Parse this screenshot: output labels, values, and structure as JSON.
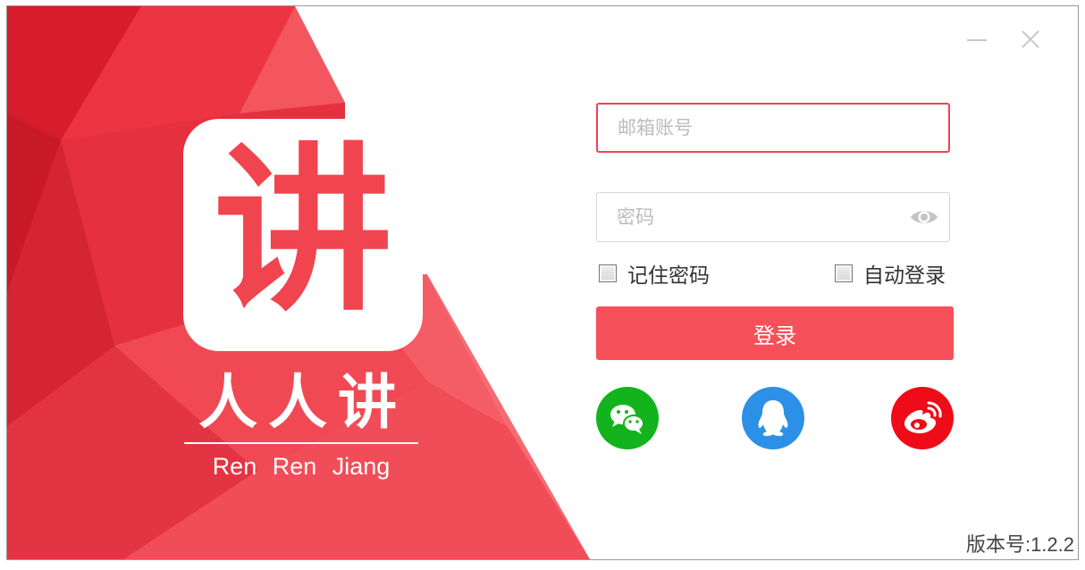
{
  "window": {
    "controls": {
      "minimize_icon": "minimize-icon",
      "close_icon": "close-icon"
    }
  },
  "brand": {
    "logo_char": "讲",
    "name": "人人讲",
    "subtitle": "Ren Ren Jiang",
    "colors": {
      "primary": "#f0444f",
      "dark": "#d7202f",
      "light": "#ff6a72"
    }
  },
  "login": {
    "email_placeholder": "邮箱账号",
    "email_value": "",
    "password_placeholder": "密码",
    "password_value": "",
    "eye_icon": "eye-icon",
    "remember_label": "记住密码",
    "remember_checked": false,
    "autologin_label": "自动登录",
    "autologin_checked": false,
    "login_button": "登录",
    "button_color": "#f6505a"
  },
  "social": [
    {
      "name": "wechat",
      "icon": "wechat-icon",
      "color": "#12b31c"
    },
    {
      "name": "qq",
      "icon": "qq-icon",
      "color": "#2b90e6"
    },
    {
      "name": "weibo",
      "icon": "weibo-icon",
      "color": "#ee0c19"
    }
  ],
  "footer": {
    "version": "版本号:1.2.2"
  }
}
